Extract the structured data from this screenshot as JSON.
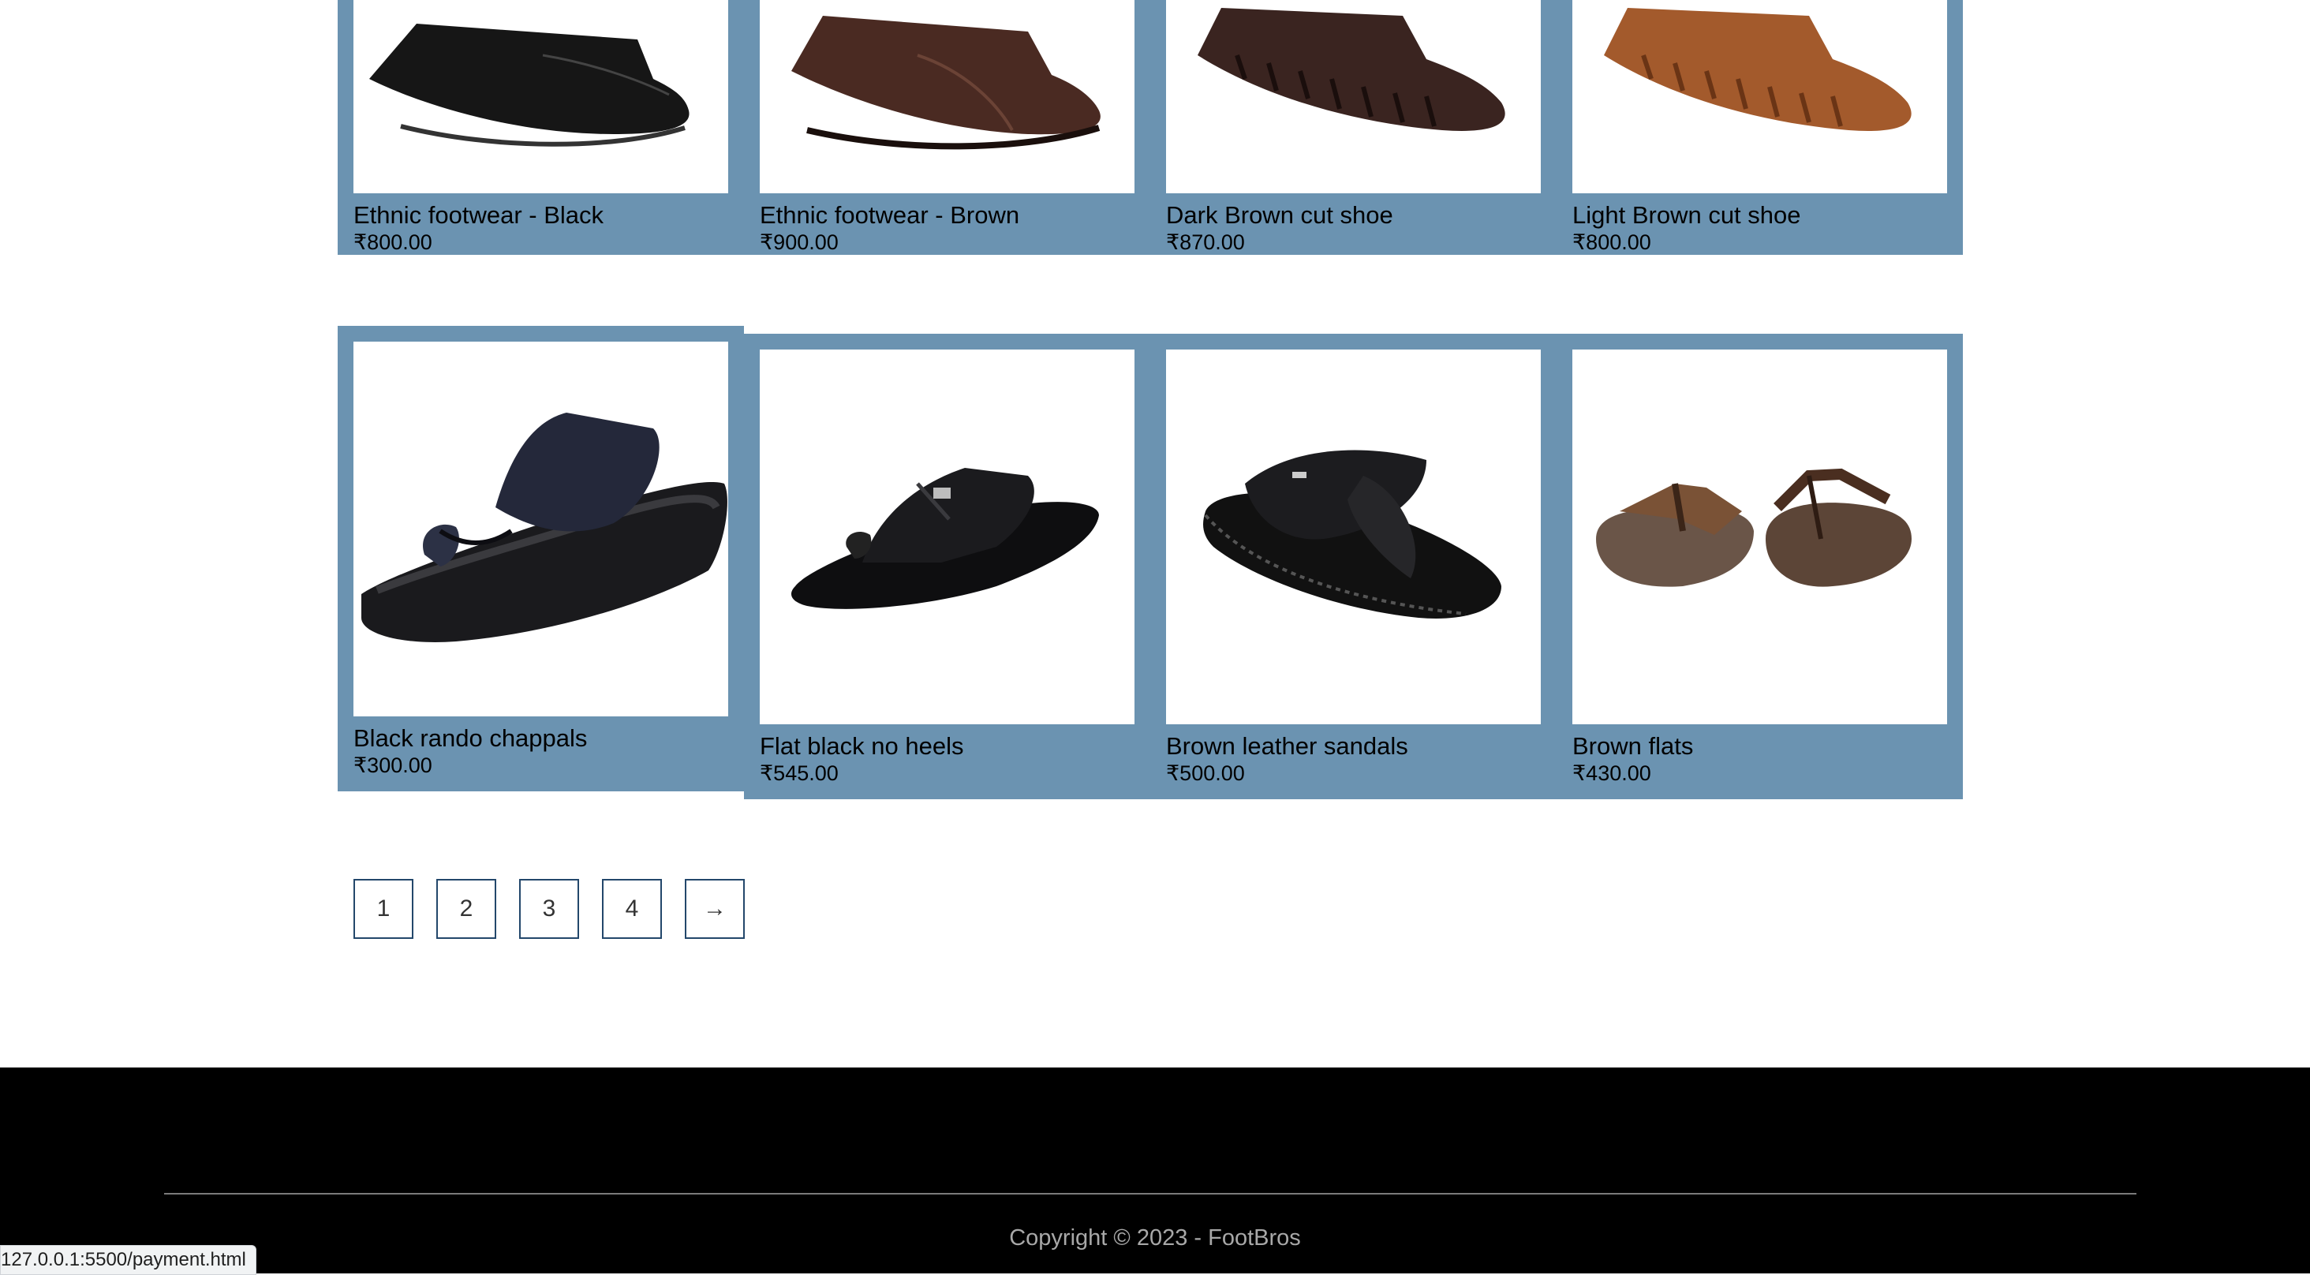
{
  "products": {
    "row1": [
      {
        "name": "Ethnic footwear - Black",
        "price": "₹800.00",
        "image": "black-loafer"
      },
      {
        "name": "Ethnic footwear - Brown",
        "price": "₹900.00",
        "image": "brown-loafer"
      },
      {
        "name": "Dark Brown cut shoe",
        "price": "₹870.00",
        "image": "dark-brown-woven-shoe"
      },
      {
        "name": "Light Brown cut shoe",
        "price": "₹800.00",
        "image": "light-brown-woven-shoe"
      }
    ],
    "row2": [
      {
        "name": "Black rando chappals",
        "price": "₹300.00",
        "image": "black-toe-ring-chappal"
      },
      {
        "name": "Flat black no heels",
        "price": "₹545.00",
        "image": "black-strap-slipper"
      },
      {
        "name": "Brown leather sandals",
        "price": "₹500.00",
        "image": "black-cross-strap-sandal"
      },
      {
        "name": "Brown flats",
        "price": "₹430.00",
        "image": "brown-flip-flops"
      }
    ]
  },
  "pagination": {
    "pages": [
      "1",
      "2",
      "3",
      "4"
    ],
    "next": "→"
  },
  "footer": {
    "copyright": "Copyright © 2023 - FootBros"
  },
  "status_bar": {
    "url": "127.0.0.1:5500/payment.html"
  },
  "colors": {
    "card_bg": "#6b93b1",
    "footer_bg": "#000000",
    "pager_border": "#23476b"
  }
}
